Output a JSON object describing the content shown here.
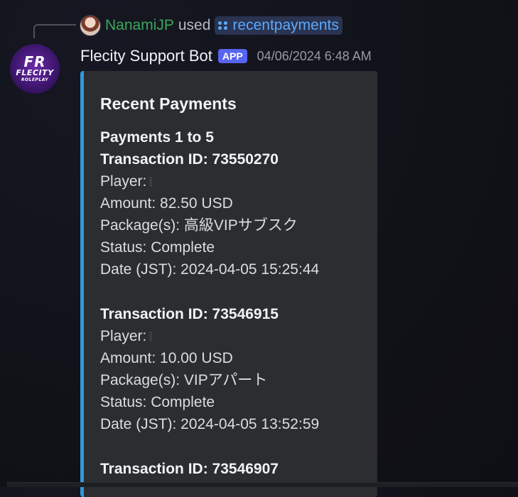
{
  "reply": {
    "user": "NanamiJP",
    "used_text": "used",
    "command": "recentpayments"
  },
  "message": {
    "bot_name": "Flecity Support Bot",
    "badge": "APP",
    "timestamp": "04/06/2024 6:48 AM",
    "avatar_text": {
      "line1": "FR",
      "line2": "FLECITY",
      "line3": "ROLEPLAY"
    }
  },
  "embed": {
    "accent_color": "#3498db",
    "title": "Recent Payments",
    "subtitle": "Payments 1 to 5",
    "transactions": [
      {
        "id_line": "Transaction ID: 73550270",
        "player": "Player:",
        "amount": "Amount: 82.50 USD",
        "package": "Package(s): 高級VIPサブスク",
        "status": "Status: Complete",
        "date": "Date (JST): 2024-04-05 15:25:44"
      },
      {
        "id_line": "Transaction ID: 73546915",
        "player": "Player:",
        "amount": "Amount: 10.00 USD",
        "package": "Package(s): VIPアパート",
        "status": "Status: Complete",
        "date": "Date (JST): 2024-04-05 13:52:59"
      },
      {
        "id_line": "Transaction ID: 73546907"
      }
    ]
  },
  "colors": {
    "background": "#111218",
    "embed_bg": "#2b2d31",
    "username_green": "#3ba55c",
    "command_blue": "#5aa9ff",
    "badge": "#5865f2"
  }
}
